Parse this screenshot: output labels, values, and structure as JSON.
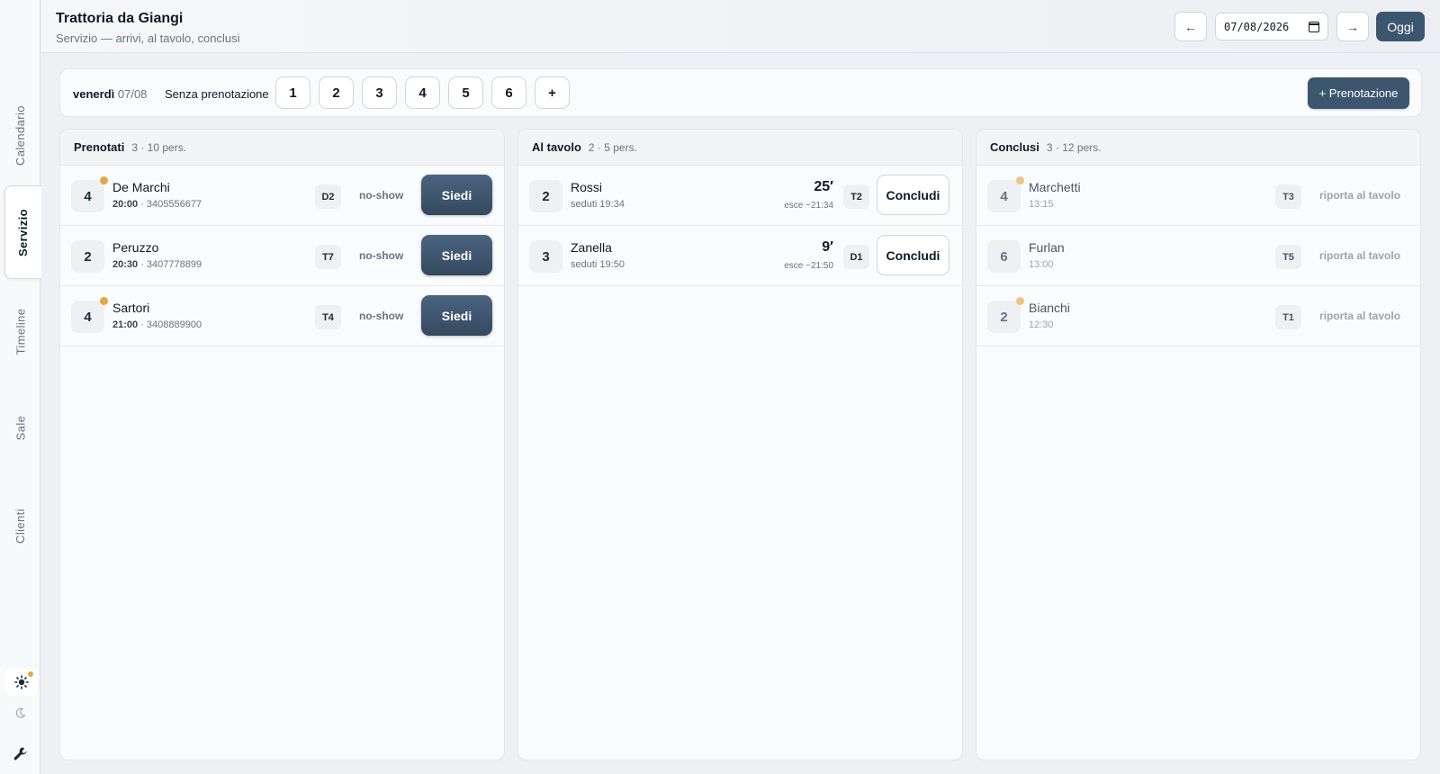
{
  "sidebar": {
    "tabs": [
      {
        "label": "Calendario"
      },
      {
        "label": "Servizio"
      },
      {
        "label": "Timeline"
      },
      {
        "label": "Sale"
      },
      {
        "label": "Clienti"
      }
    ],
    "active_tab": "Servizio",
    "icons": [
      "sun-icon",
      "moon-icon",
      "wrench-icon"
    ]
  },
  "header": {
    "title": "Trattoria da Giangi",
    "subtitle": "Servizio — arrivi, al tavolo, conclusi",
    "prev_label": "←",
    "next_label": "→",
    "date_value": "07/08/2026",
    "today_label": "Oggi"
  },
  "walkin": {
    "weekday": "venerdì",
    "date": "07/08",
    "label": "Senza prenotazione",
    "sizes": [
      "1",
      "2",
      "3",
      "4",
      "5",
      "6",
      "+"
    ],
    "new_reservation_label": "+ Prenotazione"
  },
  "columns": {
    "booked": {
      "title": "Prenotati",
      "meta": "3 · 10 pers.",
      "noshow_label": "no-show",
      "seat_label": "Siedi",
      "rows": [
        {
          "party": "4",
          "flag": true,
          "name": "De Marchi",
          "time": "20:00",
          "phone": " · 3405556677",
          "table": "D2"
        },
        {
          "party": "2",
          "flag": false,
          "name": "Peruzzo",
          "time": "20:30",
          "phone": " · 3407778899",
          "table": "T7"
        },
        {
          "party": "4",
          "flag": true,
          "name": "Sartori",
          "time": "21:00",
          "phone": " · 3408889900",
          "table": "T4"
        }
      ]
    },
    "seated": {
      "title": "Al tavolo",
      "meta": "2 · 5 pers.",
      "close_label": "Concludi",
      "rows": [
        {
          "party": "2",
          "name": "Rossi",
          "seated": "seduti 19:34",
          "elapsed": "25′",
          "exits": "esce ~21:34",
          "table": "T2"
        },
        {
          "party": "3",
          "name": "Zanella",
          "seated": "seduti 19:50",
          "elapsed": "9′",
          "exits": "esce ~21:50",
          "table": "D1"
        }
      ]
    },
    "done": {
      "title": "Conclusi",
      "meta": "3 · 12 pers.",
      "reopen_label": "riporta al tavolo",
      "rows": [
        {
          "party": "4",
          "flag": true,
          "name": "Marchetti",
          "time": "13:15",
          "table": "T3"
        },
        {
          "party": "6",
          "flag": false,
          "name": "Furlan",
          "time": "13:00",
          "table": "T5"
        },
        {
          "party": "2",
          "flag": true,
          "name": "Bianchi",
          "time": "12:30",
          "table": "T1"
        }
      ]
    }
  },
  "colors": {
    "primary": "#3d5670",
    "flag": "#e0a84a",
    "background": "#eef0f4"
  }
}
